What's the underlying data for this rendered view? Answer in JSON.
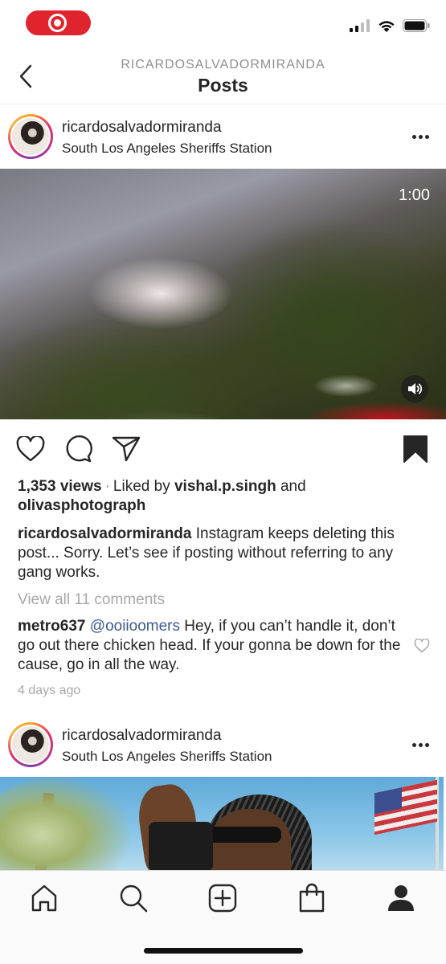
{
  "status_bar": {
    "recording_color": "#e0242e",
    "icons": [
      "recording-icon",
      "cellular-signal-icon",
      "wifi-icon",
      "battery-icon"
    ]
  },
  "nav": {
    "username": "RICARDOSALVADORMIRANDA",
    "title": "Posts",
    "back_icon": "chevron-left-icon"
  },
  "posts": [
    {
      "username": "ricardosalvadormiranda",
      "location": "South Los Angeles Sheriffs Station",
      "media": {
        "type": "video",
        "duration": "1:00",
        "sound_icon": "speaker-icon"
      },
      "actions": [
        "heart-icon",
        "comment-icon",
        "share-icon",
        "bookmark-icon"
      ],
      "saved": true,
      "views": "1,353 views",
      "separator": "·",
      "liked_by_prefix": "Liked by",
      "liked_by_user": "vishal.p.singh",
      "liked_by_and": "and",
      "liked_by_user2": "olivasphotograph",
      "caption_user": "ricardosalvadormiranda",
      "caption_text": "Instagram keeps deleting this post... Sorry. Let’s see if posting without referring to any gang works.",
      "view_comments": "View all 11 comments",
      "comment": {
        "user": "metro637",
        "mention": "@ooiioomers",
        "text": "Hey, if you can’t handle it, don’t go out there chicken head. If your gonna be down for the cause, go in all the way."
      },
      "time": "4 days ago"
    },
    {
      "username": "ricardosalvadormiranda",
      "location": "South Los Angeles Sheriffs Station",
      "media": {
        "type": "image"
      }
    }
  ],
  "tab_bar": {
    "tabs": [
      "home-icon",
      "search-icon",
      "new-post-icon",
      "shop-icon",
      "profile-icon"
    ]
  },
  "colors": {
    "text": "#262626",
    "muted": "#8e8e8e",
    "mention": "#3c5a88"
  }
}
